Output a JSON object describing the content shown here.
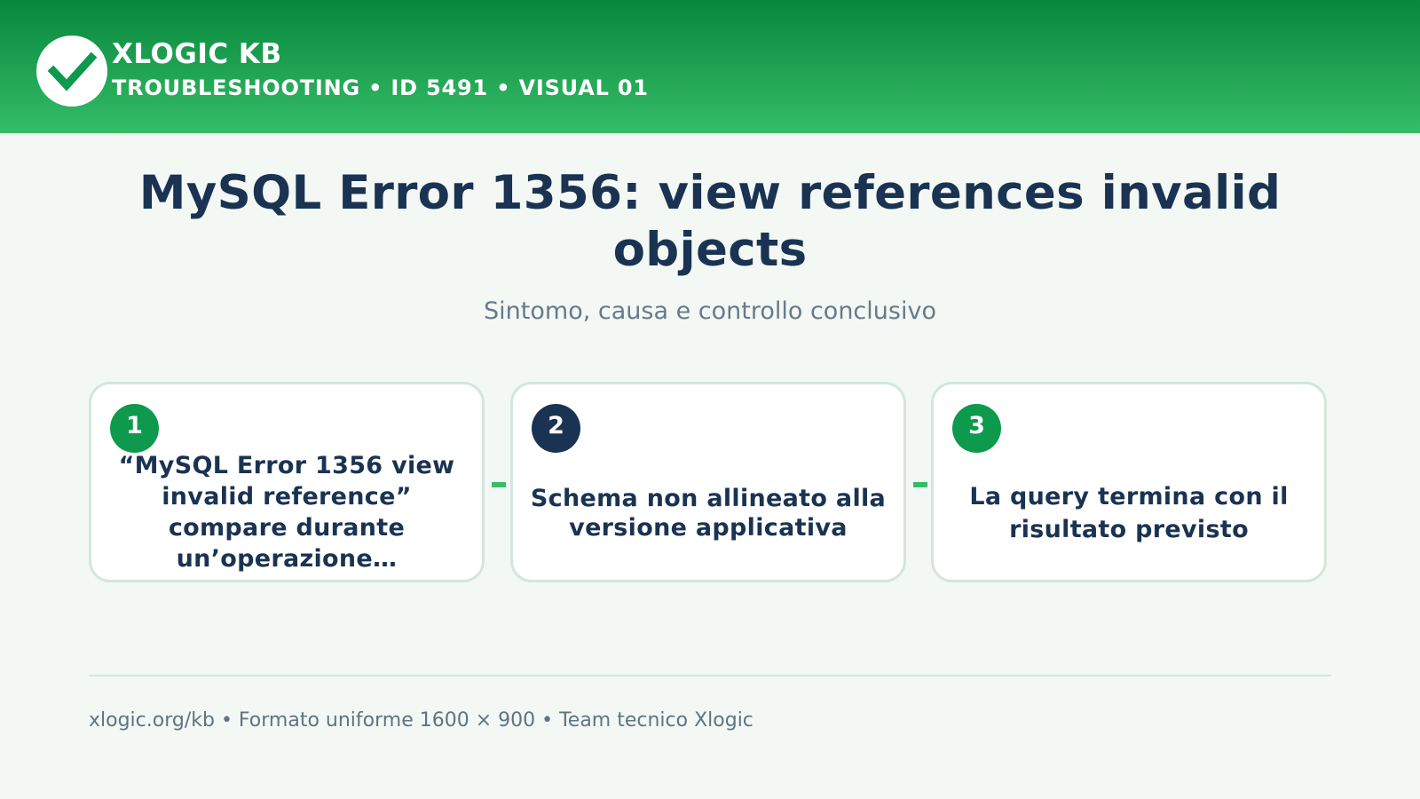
{
  "header": {
    "logo_icon": "checkmark-icon",
    "brand": "XLOGIC KB",
    "tagline": "TROUBLESHOOTING • ID 5491 • VISUAL 01"
  },
  "title": "MySQL Error 1356: view references invalid objects",
  "subtitle": "Sintomo, causa e controllo conclusivo",
  "steps": [
    {
      "number": "1",
      "text": "“MySQL Error 1356 view invalid reference” compare durante un’operazione…"
    },
    {
      "number": "2",
      "text": "Schema non allineato alla versione applicativa"
    },
    {
      "number": "3",
      "text": "La query termina con il risultato previsto"
    }
  ],
  "footer": "xlogic.org/kb • Formato uniforme 1600 × 900 • Team tecnico Xlogic",
  "colors": {
    "header_dark": "#07873c",
    "header_light": "#35bd67",
    "accent_green": "#0d9a4d",
    "navy": "#1a3352",
    "background": "#f3f8f5"
  }
}
